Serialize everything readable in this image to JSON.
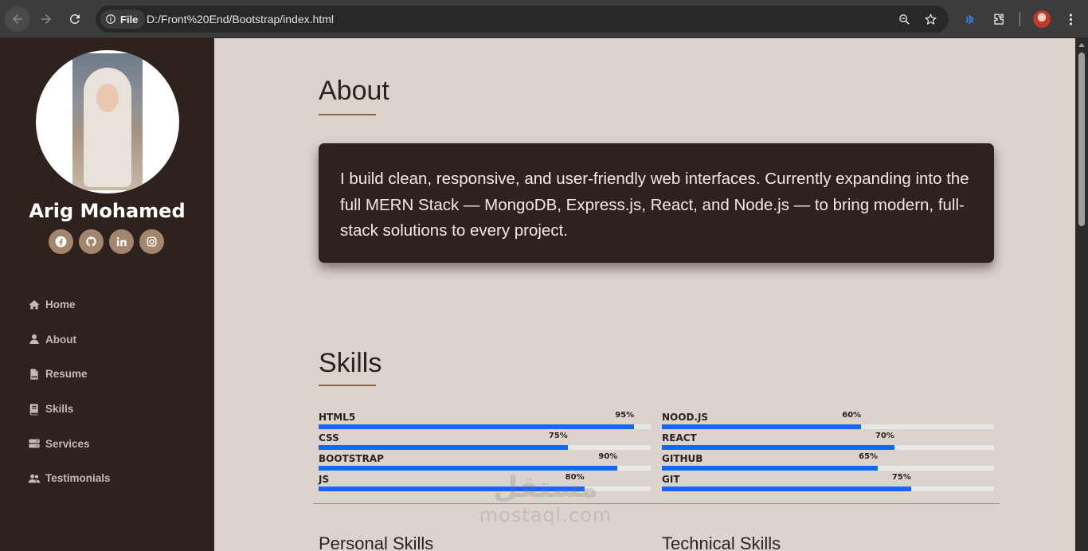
{
  "browser": {
    "security_label": "File",
    "url": "D:/Front%20End/Bootstrap/index.html",
    "icons": [
      "back-arrow",
      "forward-arrow",
      "reload",
      "info",
      "zoom",
      "star",
      "extension-wave",
      "puzzle",
      "profile-avatar",
      "kebab-menu"
    ]
  },
  "sidebar": {
    "name": "Arig Mohamed",
    "socials": [
      "facebook-icon",
      "github-icon",
      "linkedin-icon",
      "instagram-icon"
    ],
    "menu": [
      {
        "label": "Home",
        "icon": "home-icon"
      },
      {
        "label": "About",
        "icon": "user-icon"
      },
      {
        "label": "Resume",
        "icon": "pdf-file-icon"
      },
      {
        "label": "Skills",
        "icon": "book-icon"
      },
      {
        "label": "Services",
        "icon": "server-icon"
      },
      {
        "label": "Testimonials",
        "icon": "users-icon"
      }
    ]
  },
  "about": {
    "title": "About",
    "text": "I build clean, responsive, and user-friendly web interfaces. Currently expanding into the full MERN Stack — MongoDB, Express.js, React, and Node.js — to bring modern, full-stack solutions to every project."
  },
  "skills": {
    "title": "Skills",
    "left": [
      {
        "name": "HTML5",
        "percent": 95,
        "percent_label": "95%"
      },
      {
        "name": "CSS",
        "percent": 75,
        "percent_label": "75%"
      },
      {
        "name": "BOOTSTRAP",
        "percent": 90,
        "percent_label": "90%"
      },
      {
        "name": "JS",
        "percent": 80,
        "percent_label": "80%"
      }
    ],
    "right": [
      {
        "name": "NOOD.JS",
        "percent": 60,
        "percent_label": "60%"
      },
      {
        "name": "REACT",
        "percent": 70,
        "percent_label": "70%"
      },
      {
        "name": "GITHUB",
        "percent": 65,
        "percent_label": "65%"
      },
      {
        "name": "GIT",
        "percent": 75,
        "percent_label": "75%"
      }
    ],
    "personal_title": "Personal Skills",
    "technical_title": "Technical Skills"
  },
  "watermark": {
    "arabic": "مستقل",
    "latin": "mostaql.com"
  },
  "colors": {
    "sidebar_bg": "#2e221f",
    "page_bg": "#dcd3cd",
    "bar_fill": "#1668f4",
    "social_bg": "#a4856d"
  }
}
